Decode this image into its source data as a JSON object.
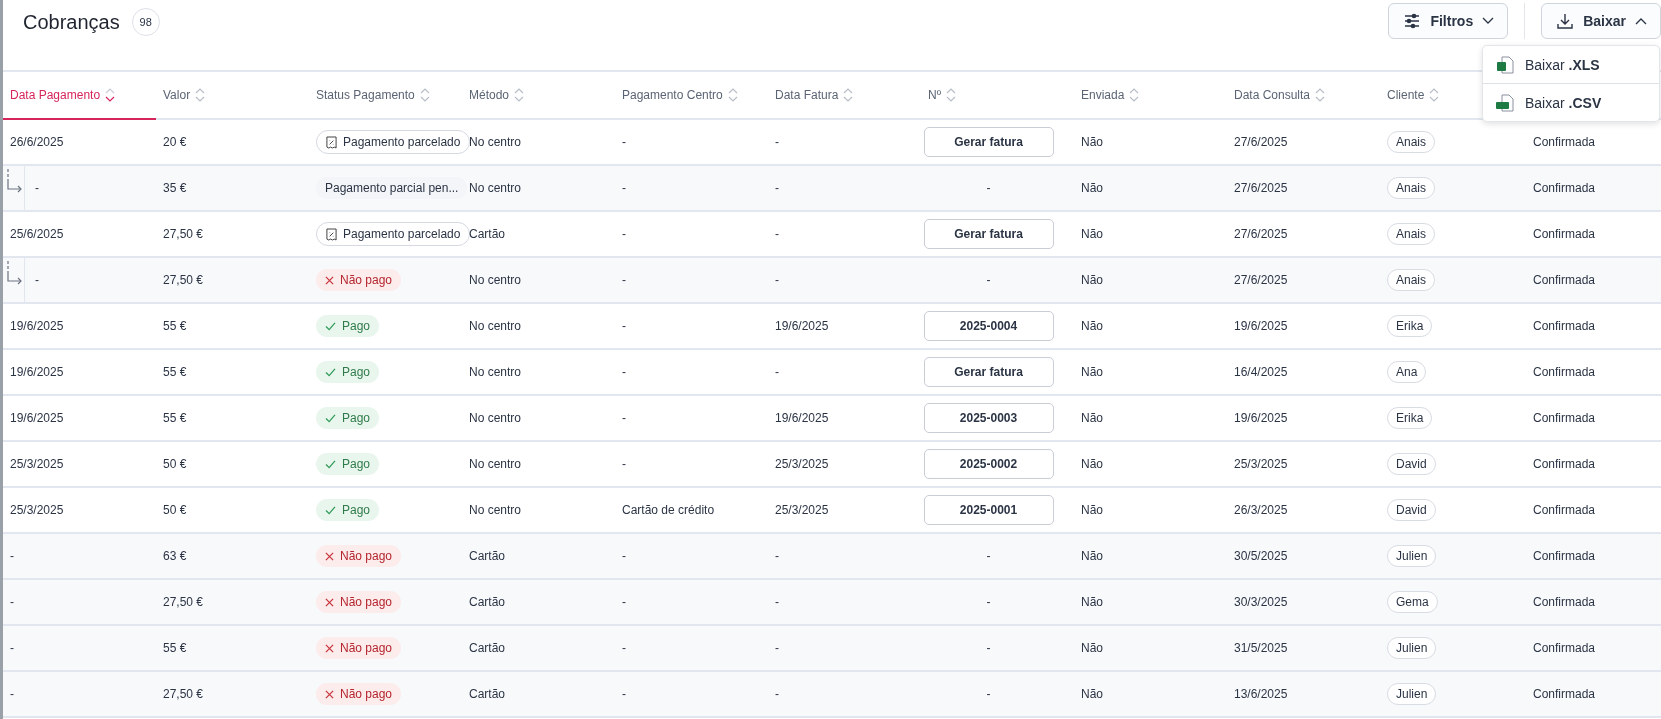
{
  "page": {
    "title": "Cobranças",
    "count": "98"
  },
  "toolbar": {
    "buttons": [
      {
        "kind": "filter",
        "label": "Filtros",
        "expanded": false
      },
      {
        "kind": "download",
        "label": "Baixar",
        "expanded": true
      }
    ]
  },
  "download_menu": [
    {
      "kind": "xls",
      "label": "Baixar **.XLS**"
    },
    {
      "kind": "csv",
      "label": "Baixar **.CSV**"
    }
  ],
  "table": {
    "columns": [
      {
        "label": "Data Pagamento",
        "selected": true
      },
      {
        "label": "Valor",
        "selected": false
      },
      {
        "label": "Status Pagamento",
        "selected": false
      },
      {
        "label": "Método",
        "selected": false
      },
      {
        "label": "Pagamento Centro",
        "selected": false
      },
      {
        "label": "Data Fatura",
        "selected": false
      },
      {
        "label": "Nº",
        "selected": false
      },
      {
        "label": "Enviada",
        "selected": false
      },
      {
        "label": "Data Consulta",
        "selected": false
      },
      {
        "label": "Cliente",
        "selected": false
      }
    ],
    "rows": [
      {
        "child": false,
        "shaded": false,
        "date": "26/6/2025",
        "amount": "20 €",
        "status": {
          "kind": "installment",
          "label": "Pagamento parcelado"
        },
        "method": "No centro",
        "center": "-",
        "invoice_date": "-",
        "number": {
          "kind": "button",
          "label": "Gerar fatura"
        },
        "sent": "Não",
        "consult_date": "27/6/2025",
        "client": "Anais",
        "state": "Confirmada"
      },
      {
        "child": true,
        "shaded": true,
        "date": "-",
        "amount": "35 €",
        "status": {
          "kind": "partial",
          "label": "Pagamento parcial pen..."
        },
        "method": "No centro",
        "center": "-",
        "invoice_date": "-",
        "number": {
          "kind": "text",
          "label": "-"
        },
        "sent": "Não",
        "consult_date": "27/6/2025",
        "client": "Anais",
        "state": "Confirmada"
      },
      {
        "child": false,
        "shaded": false,
        "date": "25/6/2025",
        "amount": "27,50 €",
        "status": {
          "kind": "installment",
          "label": "Pagamento parcelado"
        },
        "method": "Cartão",
        "center": "-",
        "invoice_date": "-",
        "number": {
          "kind": "button",
          "label": "Gerar fatura"
        },
        "sent": "Não",
        "consult_date": "27/6/2025",
        "client": "Anais",
        "state": "Confirmada"
      },
      {
        "child": true,
        "shaded": true,
        "date": "-",
        "amount": "27,50 €",
        "status": {
          "kind": "unpaid",
          "label": "Não pago"
        },
        "method": "No centro",
        "center": "-",
        "invoice_date": "-",
        "number": {
          "kind": "text",
          "label": "-"
        },
        "sent": "Não",
        "consult_date": "27/6/2025",
        "client": "Anais",
        "state": "Confirmada"
      },
      {
        "child": false,
        "shaded": false,
        "date": "19/6/2025",
        "amount": "55 €",
        "status": {
          "kind": "paid",
          "label": "Pago"
        },
        "method": "No centro",
        "center": "-",
        "invoice_date": "19/6/2025",
        "number": {
          "kind": "button",
          "label": "2025-0004"
        },
        "sent": "Não",
        "consult_date": "19/6/2025",
        "client": "Erika",
        "state": "Confirmada"
      },
      {
        "child": false,
        "shaded": false,
        "date": "19/6/2025",
        "amount": "55 €",
        "status": {
          "kind": "paid",
          "label": "Pago"
        },
        "method": "No centro",
        "center": "-",
        "invoice_date": "-",
        "number": {
          "kind": "button",
          "label": "Gerar fatura"
        },
        "sent": "Não",
        "consult_date": "16/4/2025",
        "client": "Ana",
        "state": "Confirmada"
      },
      {
        "child": false,
        "shaded": false,
        "date": "19/6/2025",
        "amount": "55 €",
        "status": {
          "kind": "paid",
          "label": "Pago"
        },
        "method": "No centro",
        "center": "-",
        "invoice_date": "19/6/2025",
        "number": {
          "kind": "button",
          "label": "2025-0003"
        },
        "sent": "Não",
        "consult_date": "19/6/2025",
        "client": "Erika",
        "state": "Confirmada"
      },
      {
        "child": false,
        "shaded": false,
        "date": "25/3/2025",
        "amount": "50 €",
        "status": {
          "kind": "paid",
          "label": "Pago"
        },
        "method": "No centro",
        "center": "-",
        "invoice_date": "25/3/2025",
        "number": {
          "kind": "button",
          "label": "2025-0002"
        },
        "sent": "Não",
        "consult_date": "25/3/2025",
        "client": "David",
        "state": "Confirmada"
      },
      {
        "child": false,
        "shaded": false,
        "date": "25/3/2025",
        "amount": "50 €",
        "status": {
          "kind": "paid",
          "label": "Pago"
        },
        "method": "No centro",
        "center": "Cartão de crédito",
        "invoice_date": "25/3/2025",
        "number": {
          "kind": "button",
          "label": "2025-0001"
        },
        "sent": "Não",
        "consult_date": "26/3/2025",
        "client": "David",
        "state": "Confirmada"
      },
      {
        "child": false,
        "shaded": true,
        "date": "-",
        "amount": "63 €",
        "status": {
          "kind": "unpaid",
          "label": "Não pago"
        },
        "method": "Cartão",
        "center": "-",
        "invoice_date": "-",
        "number": {
          "kind": "text",
          "label": "-"
        },
        "sent": "Não",
        "consult_date": "30/5/2025",
        "client": "Julien",
        "state": "Confirmada"
      },
      {
        "child": false,
        "shaded": true,
        "date": "-",
        "amount": "27,50 €",
        "status": {
          "kind": "unpaid",
          "label": "Não pago"
        },
        "method": "Cartão",
        "center": "-",
        "invoice_date": "-",
        "number": {
          "kind": "text",
          "label": "-"
        },
        "sent": "Não",
        "consult_date": "30/3/2025",
        "client": "Gema",
        "state": "Confirmada"
      },
      {
        "child": false,
        "shaded": true,
        "date": "-",
        "amount": "55 €",
        "status": {
          "kind": "unpaid",
          "label": "Não pago"
        },
        "method": "Cartão",
        "center": "-",
        "invoice_date": "-",
        "number": {
          "kind": "text",
          "label": "-"
        },
        "sent": "Não",
        "consult_date": "31/5/2025",
        "client": "Julien",
        "state": "Confirmada"
      },
      {
        "child": false,
        "shaded": true,
        "date": "-",
        "amount": "27,50 €",
        "status": {
          "kind": "unpaid",
          "label": "Não pago"
        },
        "method": "Cartão",
        "center": "-",
        "invoice_date": "-",
        "number": {
          "kind": "text",
          "label": "-"
        },
        "sent": "Não",
        "consult_date": "13/6/2025",
        "client": "Julien",
        "state": "Confirmada"
      }
    ]
  }
}
